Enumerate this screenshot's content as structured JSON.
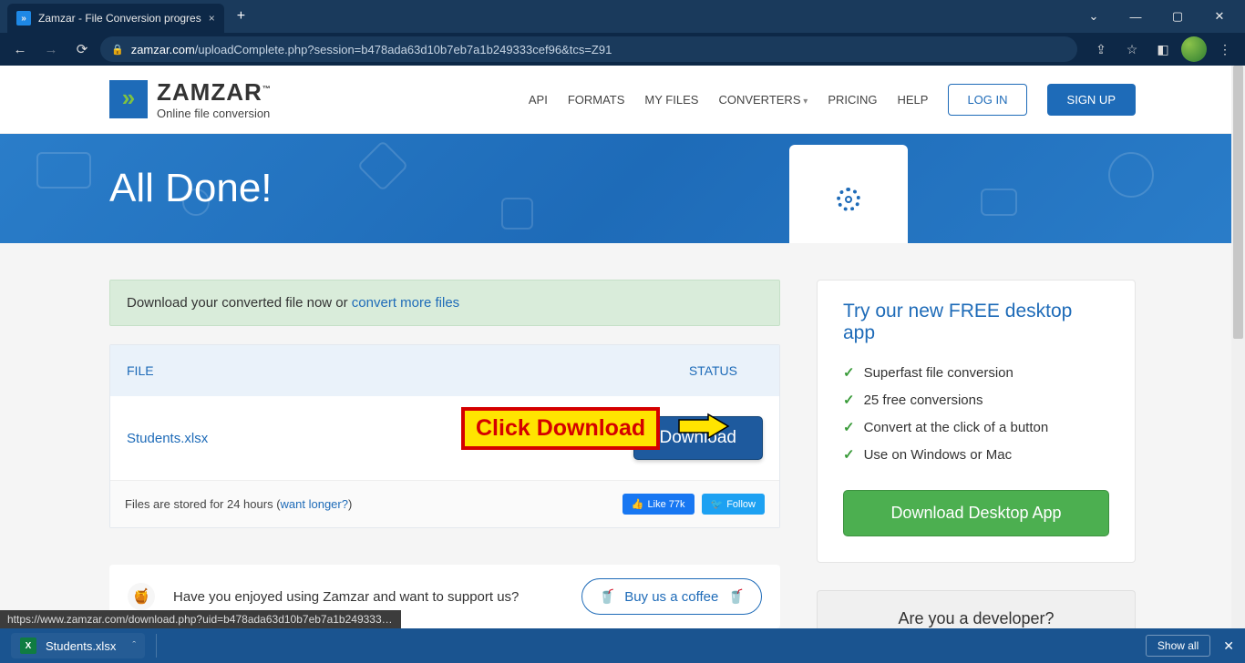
{
  "browser": {
    "tab_title": "Zamzar - File Conversion progres",
    "url_host": "zamzar.com",
    "url_path": "/uploadComplete.php?session=b478ada63d10b7eb7a1b249333cef96&tcs=Z91",
    "status_link": "https://www.zamzar.com/download.php?uid=b478ada63d10b7eb7a1b249333cef..."
  },
  "logo": {
    "brand": "ZAMZAR",
    "tm": "™",
    "tagline": "Online file conversion"
  },
  "nav": {
    "api": "API",
    "formats": "FORMATS",
    "myfiles": "MY FILES",
    "converters": "CONVERTERS",
    "pricing": "PRICING",
    "help": "HELP",
    "login": "LOG IN",
    "signup": "SIGN UP"
  },
  "hero": {
    "title": "All Done!"
  },
  "alert": {
    "text": "Download your converted file now or ",
    "link": "convert more files"
  },
  "table": {
    "col_file": "FILE",
    "col_status": "STATUS",
    "file_name": "Students.xlsx",
    "download": "Download",
    "annot": "Click Download",
    "footer_text": "Files are stored for 24 hours (",
    "footer_link": "want longer?",
    "footer_close": ")",
    "like": "Like 77k",
    "follow": "Follow"
  },
  "support": {
    "text": "Have you enjoyed using Zamzar and want to support us?",
    "button": "Buy us a coffee"
  },
  "sidebar": {
    "title": "Try our new FREE desktop app",
    "features": [
      "Superfast file conversion",
      "25 free conversions",
      "Convert at the click of a button",
      "Use on Windows or Mac"
    ],
    "cta": "Download Desktop App",
    "dev_title": "Are you a developer?"
  },
  "shelf": {
    "file": "Students.xlsx",
    "showall": "Show all"
  }
}
